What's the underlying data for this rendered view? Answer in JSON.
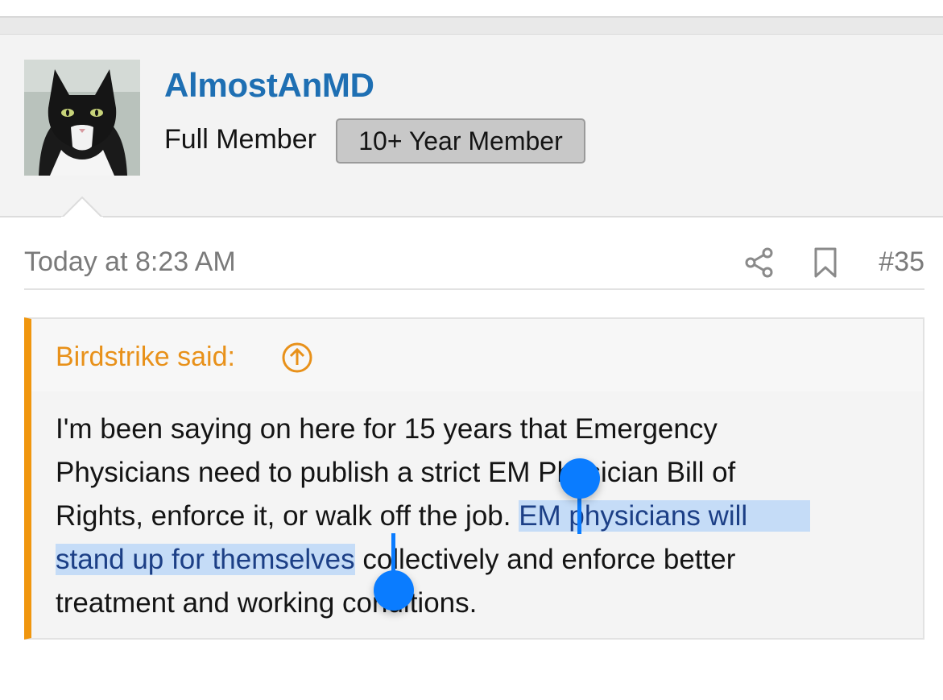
{
  "post": {
    "author": {
      "name": "AlmostAnMD",
      "role": "Full Member",
      "badge": "10+ Year Member"
    },
    "timestamp": "Today at 8:23 AM",
    "post_number": "#35",
    "quote": {
      "attribution": "Birdstrike said:",
      "lines": [
        "I'm been saying on here for 15 years that Emergency",
        "Physicians need to publish a strict EM Physician Bill of",
        "Rights, enforce it, or walk off the job. ",
        "stand up for themselves",
        "treatment and working conditions."
      ],
      "selected_part_1": "EM physicians will",
      "selected_part_2": "stand up for themselves",
      "line4_rest": " collectively and enforce better"
    }
  },
  "colors": {
    "accent_blue": "#1e6fb3",
    "quote_orange": "#f0960e",
    "selection": "#c5dcf7",
    "handle": "#0a7cff"
  }
}
